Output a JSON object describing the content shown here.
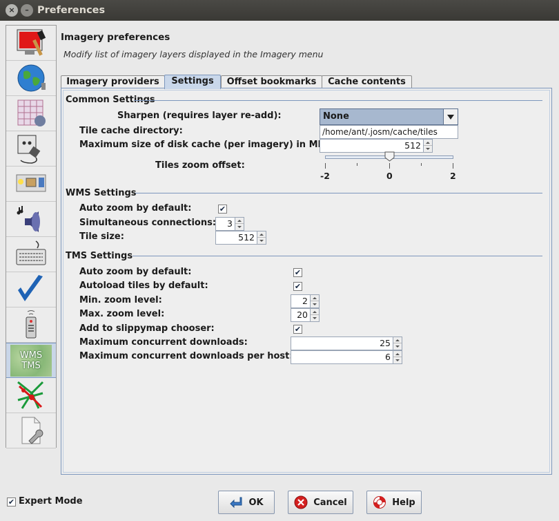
{
  "window": {
    "title": "Preferences"
  },
  "header": {
    "title": "Imagery preferences",
    "subtitle": "Modify list of imagery layers displayed in the Imagery menu"
  },
  "tabs": [
    {
      "label": "Imagery providers"
    },
    {
      "label": "Settings"
    },
    {
      "label": "Offset bookmarks"
    },
    {
      "label": "Cache contents"
    }
  ],
  "sidebar": {
    "items": [
      {
        "icon": "display-paint-icon"
      },
      {
        "icon": "globe-icon"
      },
      {
        "icon": "projection-grid-icon"
      },
      {
        "icon": "power-plug-icon"
      },
      {
        "icon": "toolbar-icon"
      },
      {
        "icon": "speaker-icon"
      },
      {
        "icon": "keyboard-icon"
      },
      {
        "icon": "checkmark-validator-icon"
      },
      {
        "icon": "remote-control-icon"
      },
      {
        "icon": "wms-tms-icon",
        "label_line1": "WMS",
        "label_line2": "TMS"
      },
      {
        "icon": "map-lines-icon"
      },
      {
        "icon": "advanced-file-wrench-icon"
      }
    ]
  },
  "common": {
    "title": "Common Settings",
    "sharpen_label": "Sharpen (requires layer re-add):",
    "sharpen_value": "None",
    "cache_dir_label": "Tile cache directory:",
    "cache_dir_value": "/home/ant/.josm/cache/tiles",
    "max_disk_label": "Maximum size of disk cache (per imagery) in MB:",
    "max_disk_value": "512",
    "zoom_offset_label": "Tiles zoom offset:",
    "zoom_offset": {
      "min": -2,
      "max": 2,
      "value": 0,
      "ticks": [
        "-2",
        "0",
        "2"
      ]
    }
  },
  "wms": {
    "title": "WMS Settings",
    "auto_zoom_label": "Auto zoom by default:",
    "auto_zoom_checked": true,
    "connections_label": "Simultaneous connections:",
    "connections_value": "3",
    "tile_size_label": "Tile size:",
    "tile_size_value": "512"
  },
  "tms": {
    "title": "TMS Settings",
    "auto_zoom_label": "Auto zoom by default:",
    "auto_zoom_checked": true,
    "autoload_label": "Autoload tiles by default:",
    "autoload_checked": true,
    "min_zoom_label": "Min. zoom level:",
    "min_zoom_value": "2",
    "max_zoom_label": "Max. zoom level:",
    "max_zoom_value": "20",
    "slippy_label": "Add to slippymap chooser:",
    "slippy_checked": true,
    "max_downloads_label": "Maximum concurrent downloads:",
    "max_downloads_value": "25",
    "max_per_host_label": "Maximum concurrent downloads per host:",
    "max_per_host_value": "6"
  },
  "footer": {
    "expert_label": "Expert Mode",
    "expert_checked": true,
    "ok_label": "OK",
    "cancel_label": "Cancel",
    "help_label": "Help"
  },
  "check_glyph": "✔"
}
